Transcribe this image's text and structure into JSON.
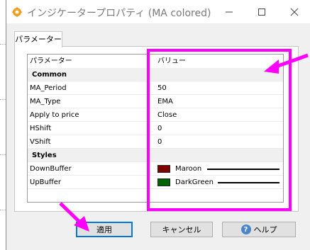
{
  "window": {
    "title": "インジケータープロパティ (MA colored)",
    "app_icon": "gear-icon"
  },
  "tabs": [
    {
      "label": "パラメーター",
      "active": true
    }
  ],
  "grid": {
    "headers": {
      "param": "パラメーター",
      "value": "バリュー"
    },
    "sections": [
      {
        "label": "Common",
        "rows": [
          {
            "name": "MA_Period",
            "value": "50"
          },
          {
            "name": "MA_Type",
            "value": "EMA"
          },
          {
            "name": "Apply to price",
            "value": "Close"
          },
          {
            "name": "HShift",
            "value": "0"
          },
          {
            "name": "VShift",
            "value": "0"
          }
        ]
      },
      {
        "label": "Styles",
        "rows": [
          {
            "name": "DownBuffer",
            "value": "Maroon",
            "color": "#800000"
          },
          {
            "name": "UpBuffer",
            "value": "DarkGreen",
            "color": "#006400"
          }
        ]
      }
    ]
  },
  "buttons": {
    "apply": "適用",
    "cancel": "キャンセル",
    "help": "ヘルプ"
  },
  "colors": {
    "annotation": "#ff00ff",
    "focus_border": "#0078d7",
    "maroon": "#800000",
    "dark_green": "#006400"
  }
}
